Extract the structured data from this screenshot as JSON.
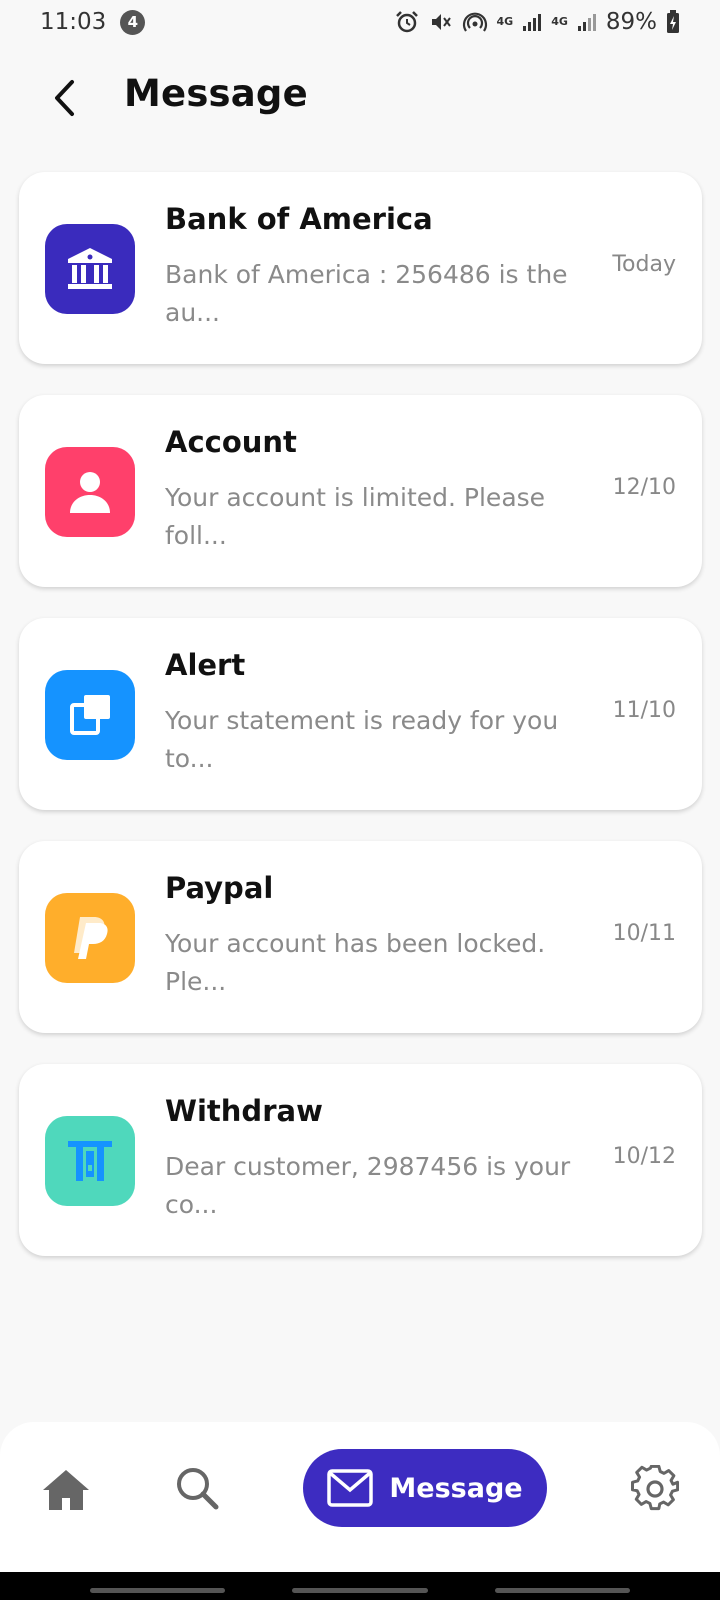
{
  "status_bar": {
    "time": "11:03",
    "notification_count": "4",
    "net1": "4G",
    "net2": "4G",
    "battery": "89%"
  },
  "header": {
    "title": "Message"
  },
  "messages": [
    {
      "title": "Bank of America",
      "preview": "Bank of America : 256486 is the au...",
      "date": "Today",
      "icon": "bank-icon",
      "color": "#3a2bbd"
    },
    {
      "title": "Account",
      "preview": "Your account is limited. Please foll...",
      "date": "12/10",
      "icon": "user-icon",
      "color": "#ff406b"
    },
    {
      "title": "Alert",
      "preview": "Your statement is ready for you to...",
      "date": "11/10",
      "icon": "statement-icon",
      "color": "#1593ff"
    },
    {
      "title": "Paypal",
      "preview": "Your account has been locked. Ple...",
      "date": "10/11",
      "icon": "paypal-icon",
      "color": "#ffae2b"
    },
    {
      "title": "Withdraw",
      "preview": "Dear customer, 2987456 is your co...",
      "date": "10/12",
      "icon": "atm-icon",
      "color": "#4fd8bc"
    }
  ],
  "bottom_nav": {
    "home_icon": "home-icon",
    "search_icon": "search-icon",
    "message_label": "Message",
    "message_icon": "mail-icon",
    "settings_icon": "gear-icon",
    "accent": "#3d2cc1"
  }
}
